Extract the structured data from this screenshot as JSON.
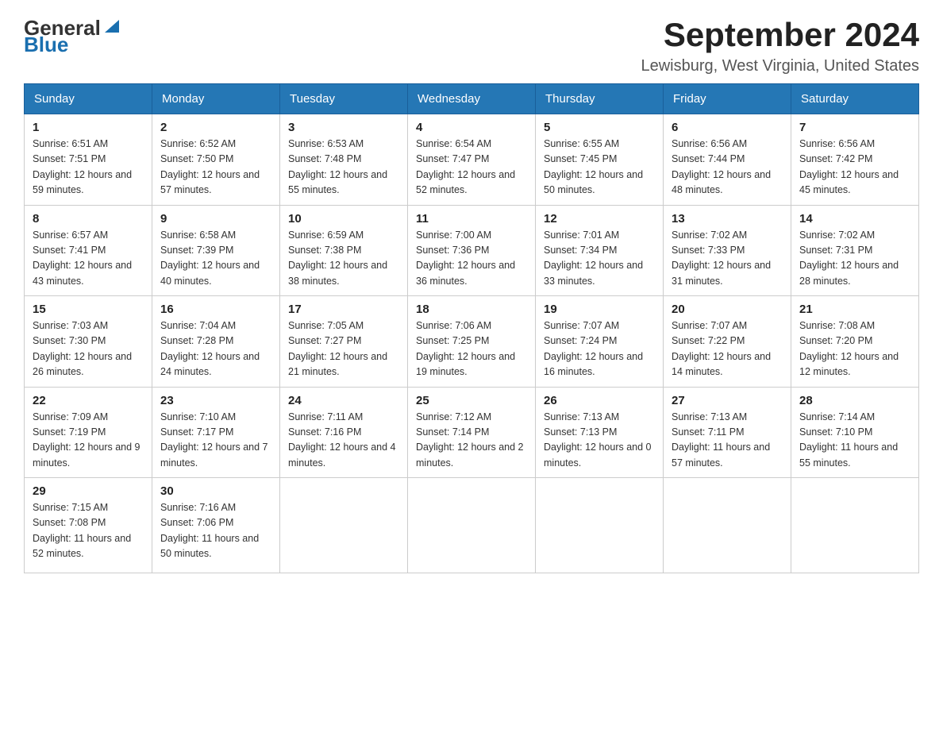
{
  "header": {
    "logo_general": "General",
    "logo_blue": "Blue",
    "title": "September 2024",
    "location": "Lewisburg, West Virginia, United States"
  },
  "days_of_week": [
    "Sunday",
    "Monday",
    "Tuesday",
    "Wednesday",
    "Thursday",
    "Friday",
    "Saturday"
  ],
  "weeks": [
    [
      {
        "day": "1",
        "sunrise": "6:51 AM",
        "sunset": "7:51 PM",
        "daylight": "12 hours and 59 minutes."
      },
      {
        "day": "2",
        "sunrise": "6:52 AM",
        "sunset": "7:50 PM",
        "daylight": "12 hours and 57 minutes."
      },
      {
        "day": "3",
        "sunrise": "6:53 AM",
        "sunset": "7:48 PM",
        "daylight": "12 hours and 55 minutes."
      },
      {
        "day": "4",
        "sunrise": "6:54 AM",
        "sunset": "7:47 PM",
        "daylight": "12 hours and 52 minutes."
      },
      {
        "day": "5",
        "sunrise": "6:55 AM",
        "sunset": "7:45 PM",
        "daylight": "12 hours and 50 minutes."
      },
      {
        "day": "6",
        "sunrise": "6:56 AM",
        "sunset": "7:44 PM",
        "daylight": "12 hours and 48 minutes."
      },
      {
        "day": "7",
        "sunrise": "6:56 AM",
        "sunset": "7:42 PM",
        "daylight": "12 hours and 45 minutes."
      }
    ],
    [
      {
        "day": "8",
        "sunrise": "6:57 AM",
        "sunset": "7:41 PM",
        "daylight": "12 hours and 43 minutes."
      },
      {
        "day": "9",
        "sunrise": "6:58 AM",
        "sunset": "7:39 PM",
        "daylight": "12 hours and 40 minutes."
      },
      {
        "day": "10",
        "sunrise": "6:59 AM",
        "sunset": "7:38 PM",
        "daylight": "12 hours and 38 minutes."
      },
      {
        "day": "11",
        "sunrise": "7:00 AM",
        "sunset": "7:36 PM",
        "daylight": "12 hours and 36 minutes."
      },
      {
        "day": "12",
        "sunrise": "7:01 AM",
        "sunset": "7:34 PM",
        "daylight": "12 hours and 33 minutes."
      },
      {
        "day": "13",
        "sunrise": "7:02 AM",
        "sunset": "7:33 PM",
        "daylight": "12 hours and 31 minutes."
      },
      {
        "day": "14",
        "sunrise": "7:02 AM",
        "sunset": "7:31 PM",
        "daylight": "12 hours and 28 minutes."
      }
    ],
    [
      {
        "day": "15",
        "sunrise": "7:03 AM",
        "sunset": "7:30 PM",
        "daylight": "12 hours and 26 minutes."
      },
      {
        "day": "16",
        "sunrise": "7:04 AM",
        "sunset": "7:28 PM",
        "daylight": "12 hours and 24 minutes."
      },
      {
        "day": "17",
        "sunrise": "7:05 AM",
        "sunset": "7:27 PM",
        "daylight": "12 hours and 21 minutes."
      },
      {
        "day": "18",
        "sunrise": "7:06 AM",
        "sunset": "7:25 PM",
        "daylight": "12 hours and 19 minutes."
      },
      {
        "day": "19",
        "sunrise": "7:07 AM",
        "sunset": "7:24 PM",
        "daylight": "12 hours and 16 minutes."
      },
      {
        "day": "20",
        "sunrise": "7:07 AM",
        "sunset": "7:22 PM",
        "daylight": "12 hours and 14 minutes."
      },
      {
        "day": "21",
        "sunrise": "7:08 AM",
        "sunset": "7:20 PM",
        "daylight": "12 hours and 12 minutes."
      }
    ],
    [
      {
        "day": "22",
        "sunrise": "7:09 AM",
        "sunset": "7:19 PM",
        "daylight": "12 hours and 9 minutes."
      },
      {
        "day": "23",
        "sunrise": "7:10 AM",
        "sunset": "7:17 PM",
        "daylight": "12 hours and 7 minutes."
      },
      {
        "day": "24",
        "sunrise": "7:11 AM",
        "sunset": "7:16 PM",
        "daylight": "12 hours and 4 minutes."
      },
      {
        "day": "25",
        "sunrise": "7:12 AM",
        "sunset": "7:14 PM",
        "daylight": "12 hours and 2 minutes."
      },
      {
        "day": "26",
        "sunrise": "7:13 AM",
        "sunset": "7:13 PM",
        "daylight": "12 hours and 0 minutes."
      },
      {
        "day": "27",
        "sunrise": "7:13 AM",
        "sunset": "7:11 PM",
        "daylight": "11 hours and 57 minutes."
      },
      {
        "day": "28",
        "sunrise": "7:14 AM",
        "sunset": "7:10 PM",
        "daylight": "11 hours and 55 minutes."
      }
    ],
    [
      {
        "day": "29",
        "sunrise": "7:15 AM",
        "sunset": "7:08 PM",
        "daylight": "11 hours and 52 minutes."
      },
      {
        "day": "30",
        "sunrise": "7:16 AM",
        "sunset": "7:06 PM",
        "daylight": "11 hours and 50 minutes."
      },
      null,
      null,
      null,
      null,
      null
    ]
  ]
}
